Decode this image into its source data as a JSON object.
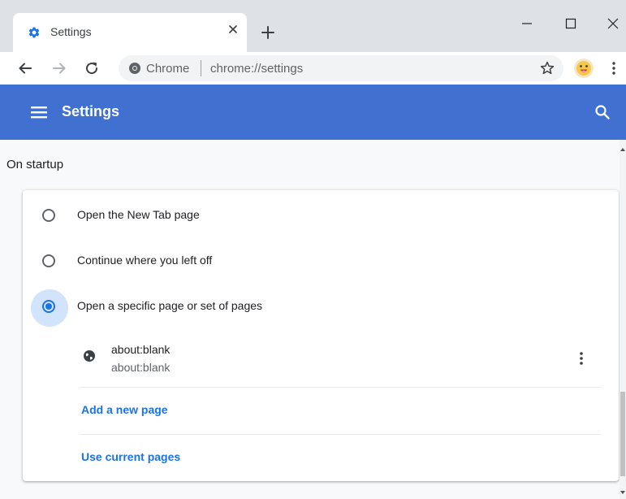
{
  "tab": {
    "title": "Settings",
    "icon": "gear-icon"
  },
  "toolbar": {
    "origin": "Chrome",
    "url": "chrome://settings"
  },
  "header": {
    "title": "Settings"
  },
  "startup": {
    "section_title": "On startup",
    "options": [
      {
        "label": "Open the New Tab page",
        "selected": false
      },
      {
        "label": "Continue where you left off",
        "selected": false
      },
      {
        "label": "Open a specific page or set of pages",
        "selected": true
      }
    ],
    "pages": [
      {
        "title": "about:blank",
        "url": "about:blank"
      }
    ],
    "add_page_label": "Add a new page",
    "use_current_label": "Use current pages"
  },
  "colors": {
    "header_bg": "#4070d0",
    "accent": "#1a73e8",
    "radio_halo": "#d2e3fc"
  }
}
